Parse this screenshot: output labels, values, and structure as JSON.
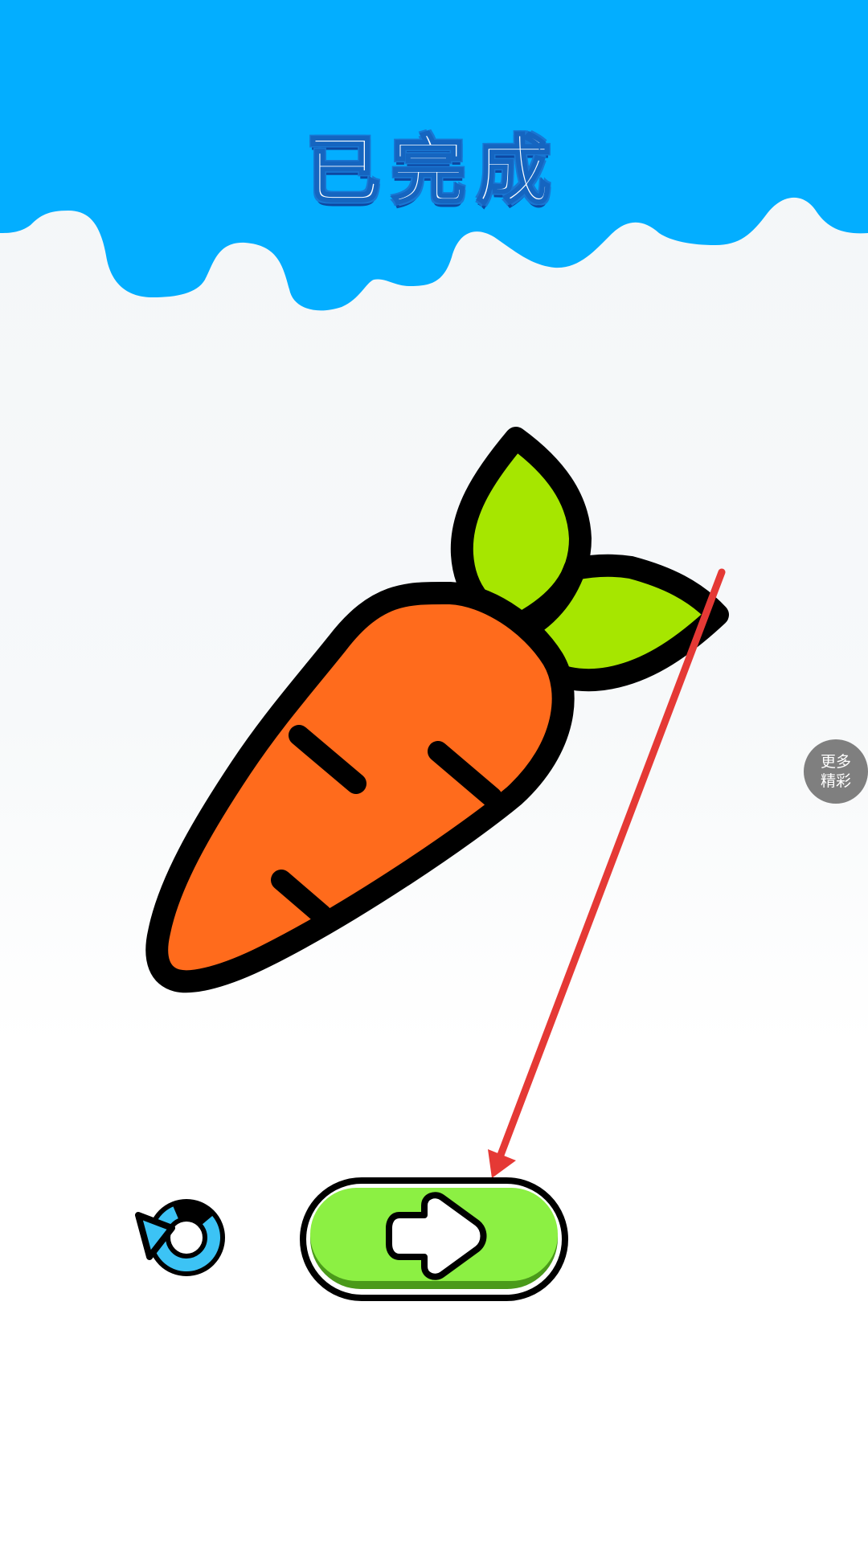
{
  "header": {
    "title": "已完成",
    "color": "#03aeff"
  },
  "artwork": {
    "subject": "carrot",
    "colors": {
      "body": "#ff6b1c",
      "leaves": "#a6e600",
      "outline": "#000000"
    }
  },
  "hint": {
    "icon": "red-arrow-pointing-to-next-button",
    "color": "#e53935"
  },
  "side_button": {
    "line1": "更多",
    "line2": "精彩",
    "color": "#7f7f7f"
  },
  "controls": {
    "restart_icon": "restart-arrow-icon",
    "restart_color": "#3cc3f5",
    "next_icon": "right-arrow-icon",
    "next_color": "#8cf043"
  }
}
